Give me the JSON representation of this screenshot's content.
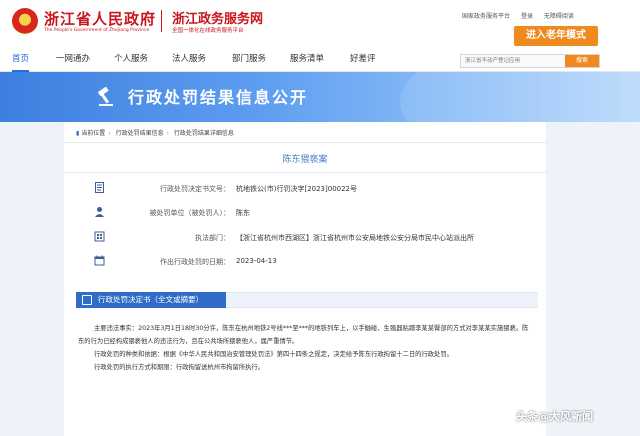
{
  "header": {
    "gov_title": "浙江省人民政府",
    "gov_subtitle": "The People's Government of Zhejiang Province",
    "portal_title": "浙江政务服务网",
    "portal_subtitle": "全国一体化在线政务服务平台",
    "top_links": [
      "国家政务服务平台",
      "登录",
      "无障碍阅读"
    ],
    "elder_button": "进入老年模式"
  },
  "nav": {
    "items": [
      "首页",
      "一网通办",
      "个人服务",
      "法人服务",
      "部门服务",
      "服务清单",
      "好差评"
    ],
    "active_index": 0
  },
  "search": {
    "placeholder": "浙江省不动产登记应用",
    "button": "搜索"
  },
  "banner": {
    "title": "行政处罚结果信息公开"
  },
  "breadcrumb": {
    "items": [
      "当前位置",
      "行政处罚结果信息",
      "行政处罚结果详细信息"
    ]
  },
  "case": {
    "title": "陈东猥亵案",
    "fields": [
      {
        "label": "行政处罚决定书文号：",
        "value": "杭地铁公(市)行罚决字[2023]00022号"
      },
      {
        "label": "被处罚单位（被处罚人）：",
        "value": "陈东"
      },
      {
        "label": "执法部门：",
        "value": "【浙江省杭州市西湖区】浙江省杭州市公安局地铁公安分局市民中心站派出所"
      },
      {
        "label": "作出行政处罚的日期：",
        "value": "2023-04-13"
      }
    ]
  },
  "section": {
    "tab_label": "行政处罚决定书（全文或摘要）",
    "paragraphs": [
      "主要违法事实：2023年3月1日18时30分许，陈东在杭州地铁2号线***至***的地铁列车上，以手触碰、生殖器贴蹭李某某臀部的方式对李某某实施猥亵。陈东的行为已经构成猥亵他人的违法行为，且在公共场所猥亵他人，属严重情节。",
      "行政处罚的种类和依据：根据《中华人民共和国治安管理处罚法》第四十四条之规定，决定给予陈东行政拘留十二日的行政处罚。",
      "行政处罚的执行方式和期限：行政拘留送杭州市拘留所执行。"
    ]
  },
  "watermark": "头条@大风新闻",
  "icons": [
    "national-emblem-icon",
    "document-icon",
    "person-icon",
    "building-icon",
    "calendar-icon",
    "hammer-icon",
    "home-icon",
    "section-doc-icon"
  ],
  "colors": {
    "brand_red": "#c8161d",
    "primary_blue": "#2f6cc8",
    "accent_orange": "#ef8a1f"
  }
}
